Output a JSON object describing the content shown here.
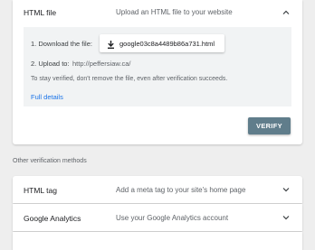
{
  "active_method": {
    "title": "HTML file",
    "description": "Upload an HTML file to your website",
    "steps": {
      "download_label": "1. Download the file:",
      "download_file": "google03c8a4489b86a731.html",
      "upload_label": "2. Upload to:",
      "upload_url": "http://peffersiaw.ca/"
    },
    "note": "To stay verified, don't remove the file, even after verification succeeds.",
    "details_link": "Full details",
    "verify_button": "VERIFY"
  },
  "other_methods": {
    "heading": "Other verification methods",
    "items": [
      {
        "title": "HTML tag",
        "description": "Add a meta tag to your site's home page"
      },
      {
        "title": "Google Analytics",
        "description": "Use your Google Analytics account"
      },
      {
        "title": "",
        "description": ""
      }
    ]
  },
  "icons": {
    "collapse": "chevron-up-icon",
    "expand": "chevron-down-icon",
    "download": "download-icon"
  }
}
